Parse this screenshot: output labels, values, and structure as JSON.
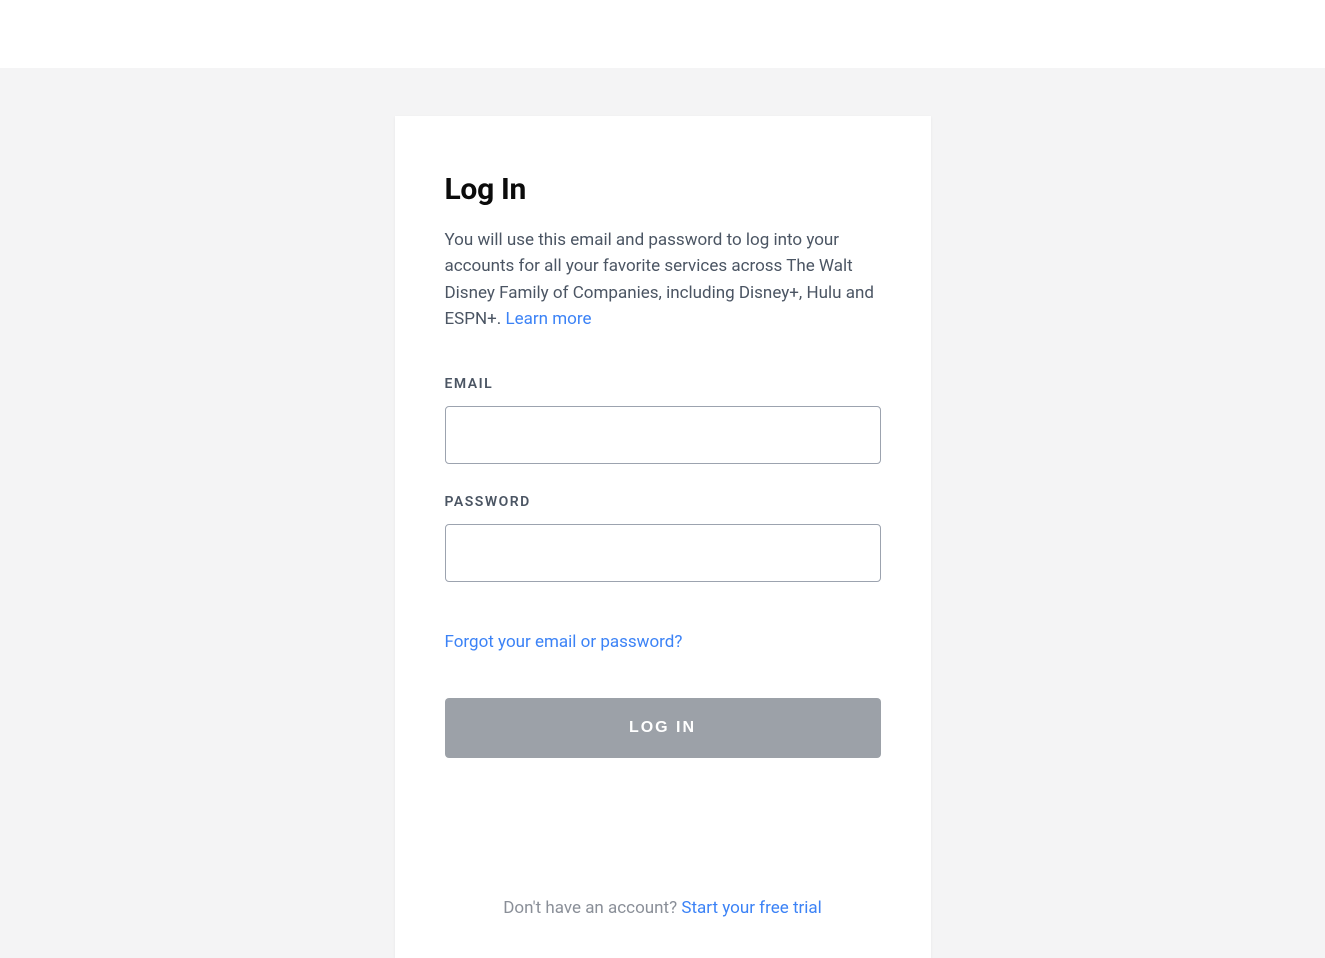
{
  "login": {
    "title": "Log In",
    "description": "You will use this email and password to log into your accounts for all your favorite services across The Walt Disney Family of Companies, including Disney+, Hulu and ESPN+. ",
    "learn_more": "Learn more",
    "email_label": "EMAIL",
    "email_value": "",
    "password_label": "PASSWORD",
    "password_value": "",
    "forgot_link": "Forgot your email or password?",
    "submit_label": "LOG IN",
    "signup_prompt": "Don't have an account? ",
    "signup_link": "Start your free trial"
  }
}
